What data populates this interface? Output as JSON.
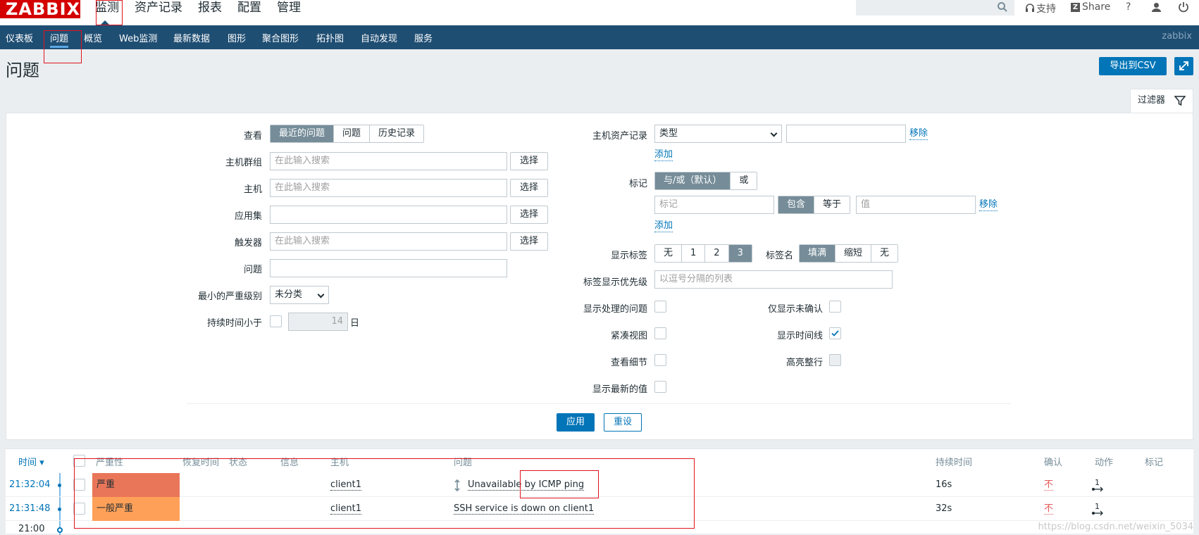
{
  "topbar": {
    "logo": "ZABBIX",
    "menu": [
      "监测",
      "资产记录",
      "报表",
      "配置",
      "管理"
    ],
    "support": "支持",
    "share": "Share",
    "help": "?"
  },
  "subnav": {
    "items": [
      "仪表板",
      "问题",
      "概览",
      "Web监测",
      "最新数据",
      "图形",
      "聚合图形",
      "拓扑图",
      "自动发现",
      "服务"
    ],
    "user": "zabbix"
  },
  "header": {
    "title": "问题",
    "export": "导出到CSV"
  },
  "filter": {
    "tab": "过滤器",
    "view_label": "查看",
    "view_options": [
      "最近的问题",
      "问题",
      "历史记录"
    ],
    "hostgroup_label": "主机群组",
    "host_label": "主机",
    "app_label": "应用集",
    "trigger_label": "触发器",
    "problem_label": "问题",
    "min_severity_label": "最小的严重级别",
    "min_severity_value": "未分类",
    "age_label": "持续时间小于",
    "age_value": "14",
    "age_unit": "日",
    "placeholder_search": "在此输入搜索",
    "select": "选择",
    "inventory_label": "主机资产记录",
    "inventory_type": "类型",
    "remove": "移除",
    "add": "添加",
    "tags_label": "标记",
    "tags_eval": [
      "与/或（默认）",
      "或"
    ],
    "tag_placeholder": "标记",
    "tag_ops": [
      "包含",
      "等于"
    ],
    "value_placeholder": "值",
    "show_tags_label": "显示标签",
    "show_tags_options": [
      "无",
      "1",
      "2",
      "3"
    ],
    "tag_name_label": "标签名",
    "tag_name_options": [
      "填满",
      "缩短",
      "无"
    ],
    "tag_priority_label": "标签显示优先级",
    "tag_priority_placeholder": "以逗号分隔的列表",
    "show_suppressed": "显示处理的问题",
    "unack_only": "仅显示未确认",
    "compact_view": "紧凑视图",
    "show_timeline": "显示时间线",
    "show_details": "查看细节",
    "highlight_row": "高亮整行",
    "show_latest": "显示最新的值",
    "apply": "应用",
    "reset": "重设"
  },
  "table": {
    "headers": {
      "time": "时间 ▾",
      "severity": "严重性",
      "recovery": "恢复时间",
      "status": "状态",
      "info": "信息",
      "host": "主机",
      "problem": "问题",
      "duration": "持续时间",
      "ack": "确认",
      "actions": "动作",
      "tags": "标记"
    },
    "rows": [
      {
        "time": "21:32:04",
        "severity": "严重",
        "sev_color": "#e97659",
        "host": "client1",
        "problem": "Unavailable by ICMP ping",
        "duration": "16s",
        "ack": "不",
        "actions": "1"
      },
      {
        "time": "21:31:48",
        "severity": "一般严重",
        "sev_color": "#ffa059",
        "host": "client1",
        "problem": "SSH service is down on client1",
        "duration": "32s",
        "ack": "不",
        "actions": "1"
      }
    ],
    "timeline_mark": "21:00"
  },
  "watermark": "https://blog.csdn.net/weixin_5034"
}
